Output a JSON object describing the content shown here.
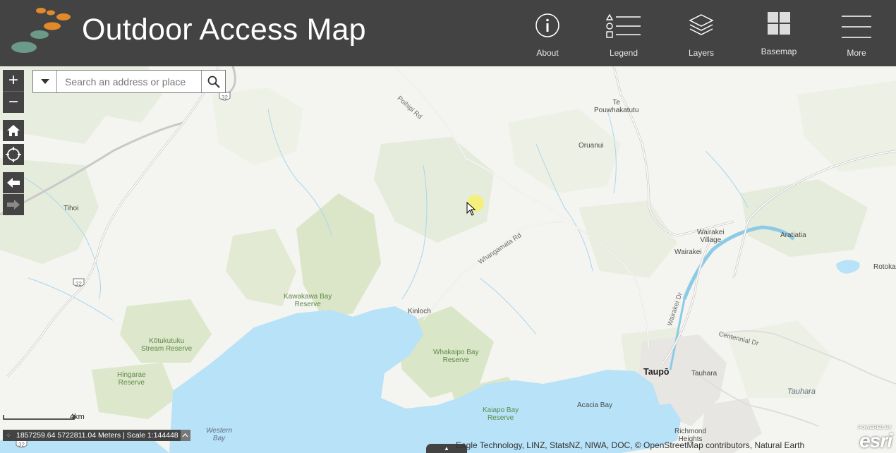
{
  "header": {
    "title": "Outdoor Access Map",
    "nav": [
      {
        "label": "About",
        "icon": "info-icon"
      },
      {
        "label": "Legend",
        "icon": "legend-icon"
      },
      {
        "label": "Layers",
        "icon": "layers-icon"
      },
      {
        "label": "Basemap",
        "icon": "basemap-icon"
      },
      {
        "label": "More",
        "icon": "menu-icon"
      }
    ]
  },
  "search": {
    "placeholder": "Search an address or place",
    "value": ""
  },
  "map_controls": {
    "zoom_in": "+",
    "zoom_out": "−",
    "home": "home-icon",
    "locate": "locate-icon",
    "back": "arrow-left-icon",
    "forward": "arrow-right-icon"
  },
  "places": {
    "poihipi_rd": "Poihipi Rd",
    "te_pouwhakatutu": "Te\nPouwhakatutu",
    "oruanui": "Oruanui",
    "tihoi": "Tihoi",
    "whangamata_rd": "Whangamata Rd",
    "wairakei_village": "Wairakei\nVillage",
    "aratiatia": "Aratiatia",
    "wairakei": "Wairakei",
    "rotoka": "Rotoka",
    "wairakei_dr": "Wairakei Dr",
    "kawakawa_bay": "Kawakawa Bay\nReserve",
    "kinloch": "Kinloch",
    "centennial_dr": "Centennial Dr",
    "kotukutuku": "Kōtukutuku\nStream Reserve",
    "whakaipo_bay": "Whakaipo Bay\nReserve",
    "taupo": "Taupō",
    "tauhara": "Tauhara",
    "tauhara_water": "Tauhara",
    "hingarae": "Hingarae\nReserve",
    "acacia_bay": "Acacia Bay",
    "kaiapo_bay": "Kaiapo Bay\nReserve",
    "richmond_heights": "Richmond\nHeights",
    "western_bay": "Western\nBay",
    "sh32_a": "32",
    "sh32_b": "32",
    "sh32_c": "32"
  },
  "footer": {
    "scale_label": "4km",
    "coordinates": "1857259.64 5722811.04 Meters | Scale 1:144448",
    "attribution": "Eagle Technology, LINZ, StatsNZ, NIWA, DOC, © OpenStreetMap contributors, Natural Earth",
    "powered_by": "POWERED BY",
    "esri": "esri"
  },
  "colors": {
    "header_bg": "#444343",
    "water": "#b7e2f8",
    "land": "#f4f4f0",
    "forest": "#e6ecdc",
    "reserve": "#d9e6c7",
    "logo_orange": "#e08a2a",
    "logo_teal": "#6b9a88"
  }
}
